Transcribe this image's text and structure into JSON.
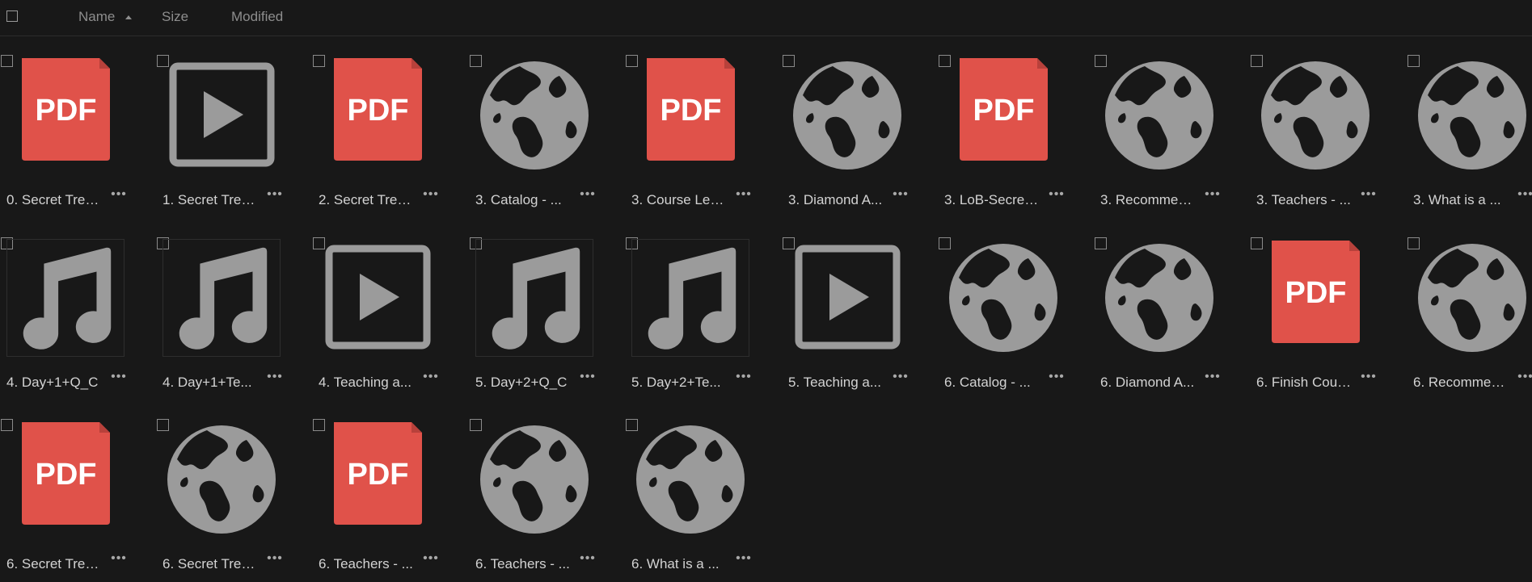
{
  "header": {
    "name_label": "Name",
    "size_label": "Size",
    "modified_label": "Modified",
    "sort_indicator": "ascending"
  },
  "colors": {
    "background": "#181818",
    "pdf_red": "#e0524a",
    "icon_gray": "#9b9b9b"
  },
  "files": [
    {
      "label": "0. Secret Trea...",
      "icon": "pdf-icon"
    },
    {
      "label": "1. Secret Trea...",
      "icon": "video-icon"
    },
    {
      "label": "2. Secret Trea...",
      "icon": "pdf-icon"
    },
    {
      "label": "3. Catalog - ...",
      "icon": "globe-icon"
    },
    {
      "label": "3. Course Lea...",
      "icon": "pdf-icon"
    },
    {
      "label": "3. Diamond A...",
      "icon": "globe-icon"
    },
    {
      "label": "3. LoB-Secret...",
      "icon": "pdf-icon"
    },
    {
      "label": "3. Recommen...",
      "icon": "globe-icon"
    },
    {
      "label": "3. Teachers - ...",
      "icon": "globe-icon"
    },
    {
      "label": "3. What is a ...",
      "icon": "globe-icon"
    },
    {
      "label": "4. Day+1+Q_C",
      "icon": "music-icon"
    },
    {
      "label": "4. Day+1+Te...",
      "icon": "music-icon"
    },
    {
      "label": "4. Teaching a...",
      "icon": "video-icon"
    },
    {
      "label": "5. Day+2+Q_C",
      "icon": "music-icon"
    },
    {
      "label": "5. Day+2+Te...",
      "icon": "music-icon"
    },
    {
      "label": "5. Teaching a...",
      "icon": "video-icon"
    },
    {
      "label": "6. Catalog - ...",
      "icon": "globe-icon"
    },
    {
      "label": "6. Diamond A...",
      "icon": "globe-icon"
    },
    {
      "label": "6. Finish Cour...",
      "icon": "pdf-icon"
    },
    {
      "label": "6. Recommen...",
      "icon": "globe-icon"
    },
    {
      "label": "6. Secret Trea...",
      "icon": "pdf-icon"
    },
    {
      "label": "6. Secret Trea...",
      "icon": "globe-icon"
    },
    {
      "label": "6. Teachers - ...",
      "icon": "pdf-icon"
    },
    {
      "label": "6. Teachers - ...",
      "icon": "globe-icon"
    },
    {
      "label": "6. What is a ...",
      "icon": "globe-icon"
    }
  ],
  "pdf_text": "PDF",
  "more_glyph": "•••"
}
